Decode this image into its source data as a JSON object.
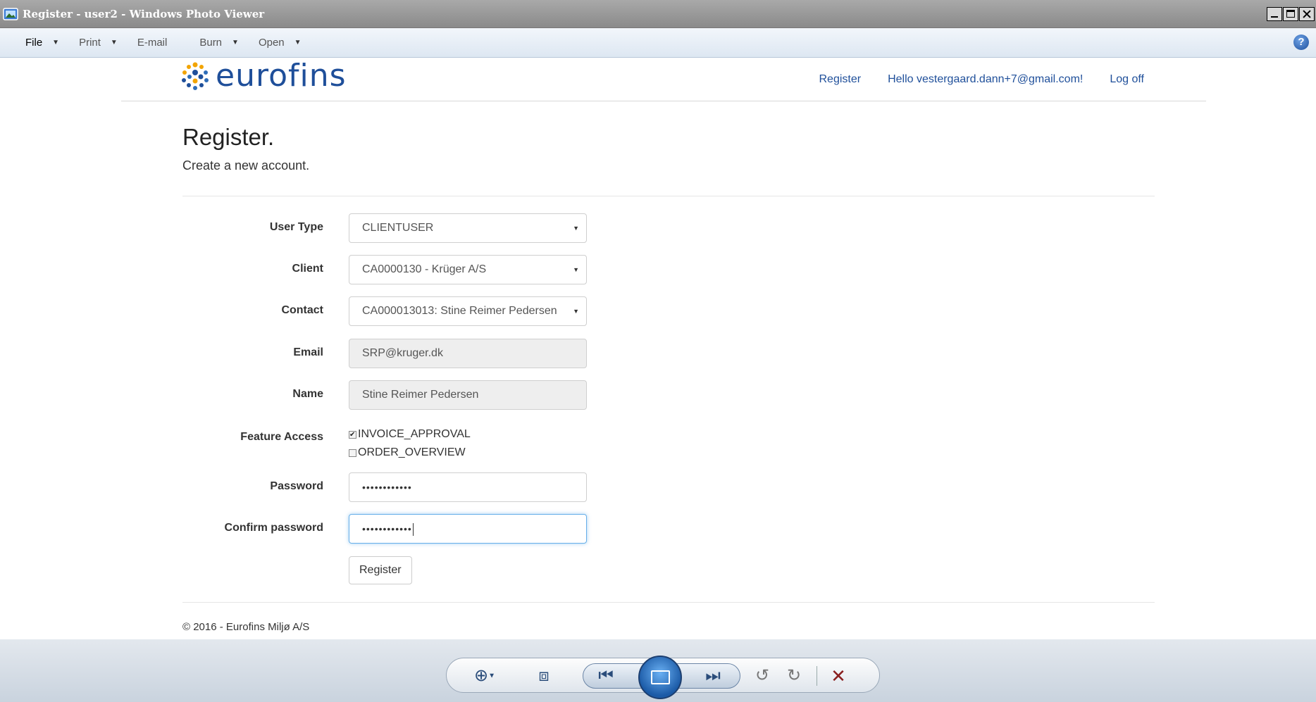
{
  "window": {
    "title": "Register - user2 - Windows Photo Viewer"
  },
  "menubar": {
    "items": [
      {
        "label": "File",
        "has_caret": true
      },
      {
        "label": "Print",
        "has_caret": true
      },
      {
        "label": "E-mail",
        "has_caret": false
      },
      {
        "label": "Burn",
        "has_caret": true
      },
      {
        "label": "Open",
        "has_caret": true
      }
    ],
    "help_icon": "help-icon"
  },
  "site": {
    "logo_text": "eurofins",
    "brand_color": "#1f4f9a",
    "nav": {
      "register": "Register",
      "hello": "Hello vestergaard.dann+7@gmail.com!",
      "logoff": "Log off"
    }
  },
  "page": {
    "title": "Register.",
    "subtitle": "Create a new account."
  },
  "form": {
    "user_type": {
      "label": "User Type",
      "value": "CLIENTUSER"
    },
    "client": {
      "label": "Client",
      "value": "CA0000130 - Krüger A/S"
    },
    "contact": {
      "label": "Contact",
      "value": "CA000013013: Stine Reimer Pedersen"
    },
    "email": {
      "label": "Email",
      "value": "SRP@kruger.dk"
    },
    "name": {
      "label": "Name",
      "value": "Stine Reimer Pedersen"
    },
    "feature_access": {
      "label": "Feature Access",
      "options": [
        {
          "label": "INVOICE_APPROVAL",
          "checked": true
        },
        {
          "label": "ORDER_OVERVIEW",
          "checked": false
        }
      ]
    },
    "password": {
      "label": "Password",
      "value": "••••••••••••"
    },
    "confirm_password": {
      "label": "Confirm password",
      "value": "••••••••••••"
    },
    "submit_label": "Register"
  },
  "footer": {
    "text": "© 2016 - Eurofins Miljø A/S"
  },
  "viewer_controls": {
    "icons": [
      "zoom-icon",
      "fit-to-window-icon",
      "previous-icon",
      "slideshow-icon",
      "next-icon",
      "rotate-left-icon",
      "rotate-right-icon",
      "delete-icon"
    ]
  }
}
